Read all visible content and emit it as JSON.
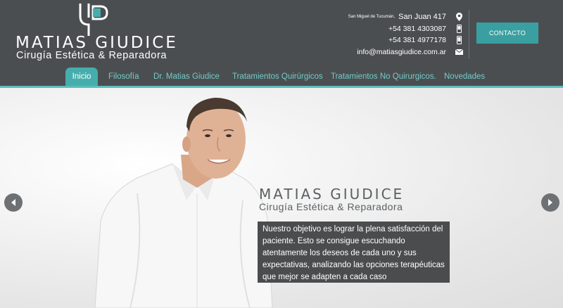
{
  "brand": {
    "name": "MATIAS GIUDICE",
    "subtitle": "Cirugía Estética & Reparadora"
  },
  "contact": {
    "city": "San Miguel de Tucumán,",
    "street": "San Juan 417",
    "phone1": "+54 381 4303087",
    "phone2": "+54 381 4977178",
    "email": "info@matiasgiudice.com.ar",
    "button_label": "CONTACTO"
  },
  "nav": {
    "items": [
      {
        "label": "Inicio",
        "active": true
      },
      {
        "label": "Filosofía"
      },
      {
        "label": "Dr. Matias Giudice"
      },
      {
        "label": "Tratamientos Quirúrgicos"
      },
      {
        "label": "Tratamientos No Quirurgicos."
      },
      {
        "label": "Novedades"
      }
    ]
  },
  "hero": {
    "name": "MATIAS GIUDICE",
    "subtitle": "Cirugía Estética & Reparadora",
    "text_lines": [
      "Nuestro objetivo es lograr la plena satisfacción del",
      "paciente. Esto se consigue escuchando",
      "atentamente los deseos de cada uno y sus",
      "expectativas, analizando las opciones terapéuticas",
      "que mejor se adapten a cada caso"
    ]
  },
  "icons": {
    "location": "map-pin-icon",
    "phone": "phone-icon",
    "mobile": "mobile-icon",
    "mail": "mail-icon",
    "prev": "chevron-left-icon",
    "next": "chevron-right-icon"
  },
  "colors": {
    "header_bg": "#4b4e50",
    "accent": "#45aeac",
    "nav_text": "#72cbc9",
    "button": "#3a9fa1",
    "text_box": "#4a4c4e"
  }
}
